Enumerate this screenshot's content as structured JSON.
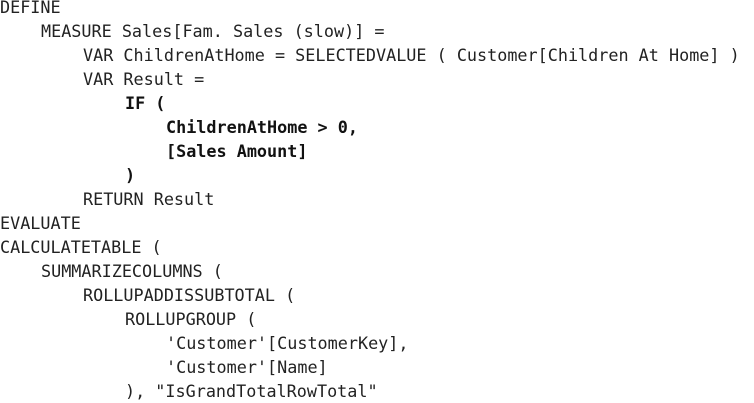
{
  "code_listing": {
    "lines": [
      "DEFINE",
      "MEASURE Sales[Fam. Sales (slow)] =",
      "VAR ChildrenAtHome = SELECTEDVALUE ( Customer[Children At Home] )",
      "VAR Result =",
      "IF (",
      "ChildrenAtHome > 0,",
      "[Sales Amount]",
      ")",
      "RETURN Result",
      "EVALUATE",
      "CALCULATETABLE (",
      "SUMMARIZECOLUMNS (",
      "ROLLUPADDISSUBTOTAL (",
      "ROLLUPGROUP (",
      "'Customer'[CustomerKey],",
      "'Customer'[Name]",
      "), \"IsGrandTotalRowTotal\""
    ]
  }
}
